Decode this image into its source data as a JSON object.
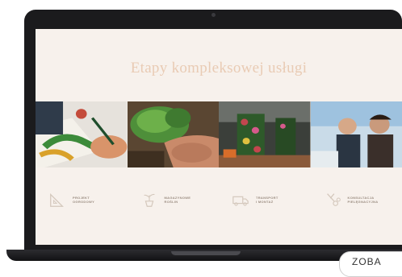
{
  "heading": "Etapy kompleksowej usługi",
  "photos": [
    {
      "name": "photo-designing"
    },
    {
      "name": "photo-plants"
    },
    {
      "name": "photo-transport"
    },
    {
      "name": "photo-consulting"
    }
  ],
  "steps": [
    {
      "icon": "ruler-triangle-icon",
      "label": "PROJEKT\nOGRODOWY"
    },
    {
      "icon": "potted-plant-icon",
      "label": "MAGAZYNOWE\nROŚLIN"
    },
    {
      "icon": "truck-icon",
      "label": "TRANSPORT\nI MONTAŻ"
    },
    {
      "icon": "pruning-shears-icon",
      "label": "KONSULTACJA\nPIELĘGNACYJNA"
    }
  ],
  "more_button": "ZOBA",
  "colors": {
    "background": "#f7f1ec",
    "heading": "#e9cbb4",
    "step_text": "#9a8c80",
    "laptop": "#1b1b1d"
  }
}
